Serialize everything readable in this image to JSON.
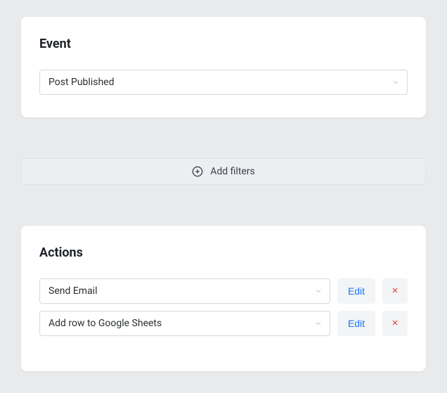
{
  "event": {
    "title": "Event",
    "selected": "Post Published"
  },
  "filters": {
    "add_label": "Add filters"
  },
  "actions": {
    "title": "Actions",
    "items": [
      {
        "label": "Send Email",
        "edit": "Edit"
      },
      {
        "label": "Add row to Google Sheets",
        "edit": "Edit"
      }
    ]
  }
}
